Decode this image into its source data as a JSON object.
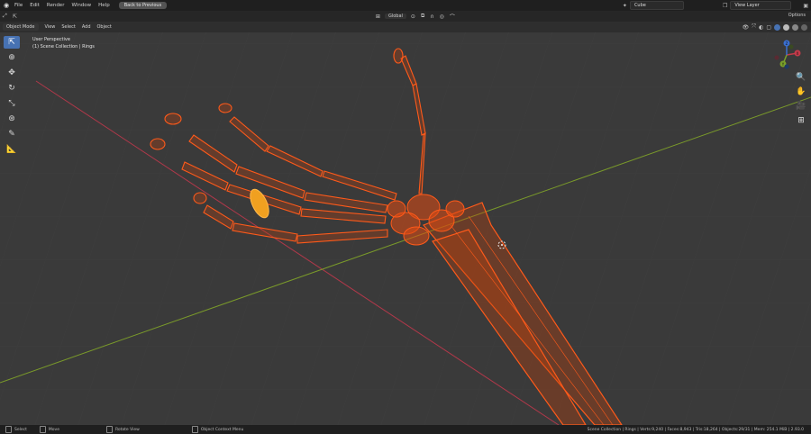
{
  "topbar": {
    "menus": [
      "File",
      "Edit",
      "Render",
      "Window",
      "Help"
    ],
    "back_button": "Back to Previous",
    "scene_name": "Cube",
    "view_layer": "View Layer"
  },
  "header2": {
    "transform_orientation": "Global",
    "options_label": "Options"
  },
  "viewport_header": {
    "mode": "Object Mode",
    "menus": [
      "View",
      "Select",
      "Add",
      "Object"
    ]
  },
  "viewport": {
    "perspective_label": "User Perspective",
    "collection_label": "(1) Scene Collection | Rings"
  },
  "statusbar": {
    "hints": [
      "Select",
      "Move",
      "Rotate View",
      "Object Context Menu"
    ],
    "stats": "Scene Collection | Rings | Verts:9,240 | Faces:8,943 | Tris:18,264 | Objects:29/31 | Mem: 254.1 MiB | 2.93.0"
  },
  "colors": {
    "wire": "#ff5a1a",
    "ring": "#f0a020",
    "x_axis": "#b0384a",
    "y_axis": "#7a9a2a",
    "accent": "#4772b3"
  },
  "icons": {
    "gizmo_x": "X",
    "gizmo_y": "Y",
    "gizmo_z": "Z"
  }
}
